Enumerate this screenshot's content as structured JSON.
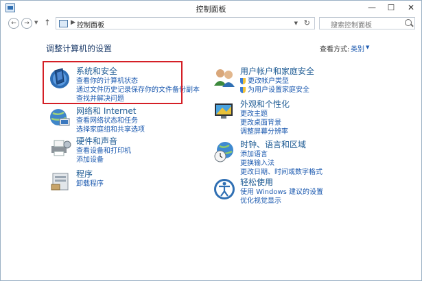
{
  "window": {
    "title": "控制面板"
  },
  "window_controls": {
    "minimize": "—",
    "maximize": "☐",
    "close": "✕"
  },
  "nav": {
    "back": "←",
    "forward": "→",
    "up": "↑",
    "breadcrumb_sep": "▶",
    "address": "控制面板",
    "refresh": "↻",
    "search_placeholder": "搜索控制面板"
  },
  "header": {
    "title": "调整计算机的设置",
    "view_label": "查看方式:",
    "view_value": "类别",
    "view_arrow": "▼"
  },
  "categories_left": [
    {
      "title": "系统和安全",
      "icon": "shield-icon",
      "links": [
        "查看你的计算机状态",
        "通过文件历史记录保存你的文件备份副本",
        "查找并解决问题"
      ]
    },
    {
      "title": "网络和 Internet",
      "icon": "network-icon",
      "links": [
        "查看网络状态和任务",
        "选择家庭组和共享选项"
      ]
    },
    {
      "title": "硬件和声音",
      "icon": "printer-icon",
      "links": [
        "查看设备和打印机",
        "添加设备"
      ]
    },
    {
      "title": "程序",
      "icon": "programs-icon",
      "links": [
        "卸载程序"
      ]
    }
  ],
  "categories_right": [
    {
      "title": "用户帐户和家庭安全",
      "icon": "users-icon",
      "links": [
        "更改帐户类型",
        "为用户设置家庭安全"
      ]
    },
    {
      "title": "外观和个性化",
      "icon": "display-icon",
      "links": [
        "更改主题",
        "更改桌面背景",
        "调整屏幕分辨率"
      ]
    },
    {
      "title": "时钟、语言和区域",
      "icon": "clock-globe-icon",
      "links": [
        "添加语言",
        "更换输入法",
        "更改日期、时间或数字格式"
      ]
    },
    {
      "title": "轻松使用",
      "icon": "accessibility-icon",
      "links": [
        "使用 Windows 建议的设置",
        "优化视觉显示"
      ]
    }
  ],
  "colors": {
    "highlight_box": "#d41f26",
    "link": "#1e5bb0",
    "title_link": "#1c5a93"
  }
}
